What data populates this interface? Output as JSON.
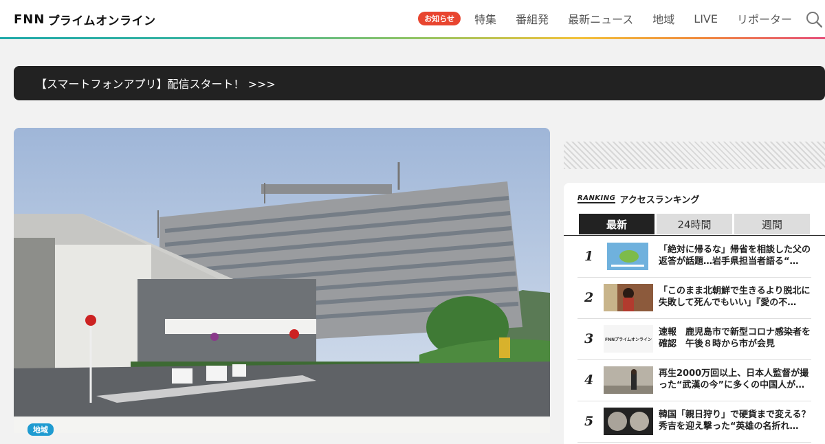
{
  "header": {
    "logo_prefix": "FNN",
    "logo_text": "プライムオンライン",
    "notice_badge": "お知らせ",
    "nav": [
      "特集",
      "番組発",
      "最新ニュース",
      "地域",
      "LIVE",
      "リポーター"
    ]
  },
  "banner": {
    "text": "【スマートフォンアプリ】配信スタート！ >>>"
  },
  "hero": {
    "tag": "地域"
  },
  "ranking": {
    "badge": "RANKING",
    "title": "アクセスランキング",
    "tabs": [
      "最新",
      "24時間",
      "週間"
    ],
    "active_tab": "最新",
    "items": [
      {
        "rank": "1",
        "title": "「絶対に帰るな」帰省を相談した父の返答が話題…岩手県担当者語る“…"
      },
      {
        "rank": "2",
        "title": "「このまま北朝鮮で生きるより脱北に失敗して死んでもいい」『愛の不…"
      },
      {
        "rank": "3",
        "title": "速報　鹿児島市で新型コロナ感染者を確認　午後８時から市が会見",
        "thumb_text": "FNNプライムオンライン"
      },
      {
        "rank": "4",
        "title": "再生2000万回以上、日本人監督が撮った“武漢の今”に多くの中国人が…"
      },
      {
        "rank": "5",
        "title": "韓国「親日狩り」で硬貨まで変える？秀吉を迎え撃った“英雄の名折れ…"
      }
    ]
  },
  "colors": {
    "accent_red": "#e8452f",
    "banner_bg": "#222222",
    "tag_blue": "#1f9bd1"
  }
}
